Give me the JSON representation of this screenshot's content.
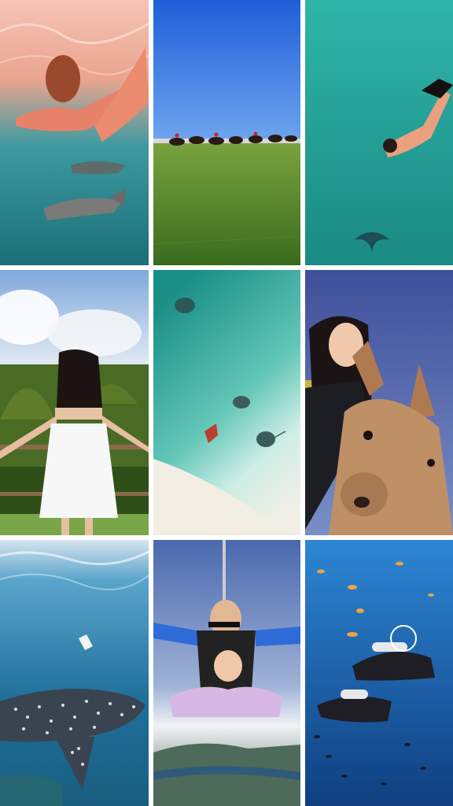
{
  "collage": {
    "layout": "3x3 photo grid",
    "tiles": [
      {
        "subject": "swimmer-with-sharks",
        "palette": [
          "#f4b6a6",
          "#2e8f97",
          "#1c6f78"
        ]
      },
      {
        "subject": "horse-race",
        "palette": [
          "#1f5fd6",
          "#5a8f2a",
          "#3d7020"
        ]
      },
      {
        "subject": "freediver-with-manta-ray",
        "palette": [
          "#2fb3a8",
          "#1f9d94",
          "#1a7f78"
        ]
      },
      {
        "subject": "woman-in-white-dress-overlooking-hills",
        "palette": [
          "#9cc2e8",
          "#4a6b24",
          "#f2f2f2"
        ]
      },
      {
        "subject": "aerial-beach-with-stingrays",
        "palette": [
          "#1f9a8e",
          "#7fd2c3",
          "#f3efe6"
        ]
      },
      {
        "subject": "selfie-with-kangaroo",
        "palette": [
          "#4d5fa8",
          "#b88a63",
          "#1d1d24"
        ]
      },
      {
        "subject": "whale-shark",
        "palette": [
          "#2a8fb8",
          "#1a5f86",
          "#3b4a5a"
        ]
      },
      {
        "subject": "tandem-skydive",
        "palette": [
          "#5a78b8",
          "#dfe4ee",
          "#3a5a7a"
        ]
      },
      {
        "subject": "scuba-divers-with-fish",
        "palette": [
          "#1f6fbf",
          "#16549a",
          "#0f3f7a"
        ]
      }
    ]
  }
}
